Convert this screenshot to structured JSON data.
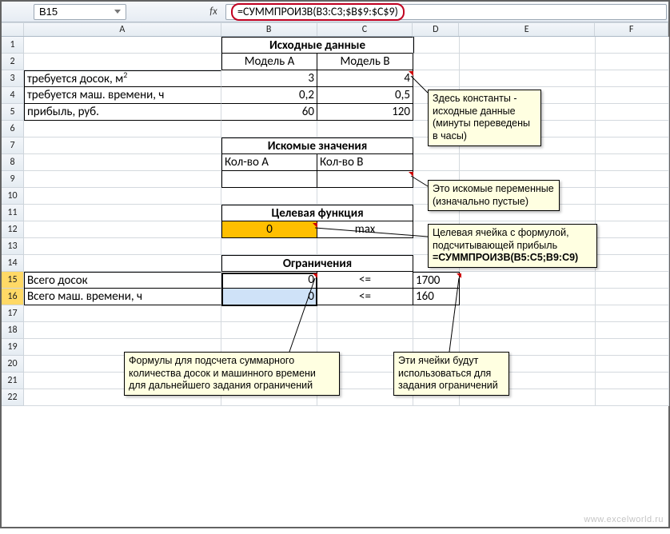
{
  "formula_bar": {
    "name_box": "B15",
    "fx": "fx",
    "formula": "=СУММПРОИЗВ(B3:C3;$B$9:$C$9)"
  },
  "cols": [
    "A",
    "B",
    "C",
    "D",
    "E",
    "F"
  ],
  "rows": [
    "1",
    "2",
    "3",
    "4",
    "5",
    "6",
    "7",
    "8",
    "9",
    "10",
    "11",
    "12",
    "13",
    "14",
    "15",
    "16",
    "17",
    "18",
    "19",
    "20",
    "21",
    "22"
  ],
  "cells": {
    "B1C1": "Исходные данные",
    "B2": "Модель A",
    "C2": "Модель B",
    "A3": "требуется досок, м",
    "A3_sup": "2",
    "B3": "3",
    "C3": "4",
    "A4": "требуется маш. времени, ч",
    "B4": "0,2",
    "C4": "0,5",
    "A5": "прибыль, руб.",
    "B5": "60",
    "C5": "120",
    "B7C7": "Искомые значения",
    "B8": "Кол-во A",
    "C8": "Кол-во B",
    "B11C11": "Целевая функция",
    "B12": "0",
    "C12": "max",
    "B14C14": "Ограничения",
    "A15": "Всего досок",
    "B15": "0",
    "C15": "<=",
    "D15": "1700",
    "A16": "Всего маш. времени, ч",
    "B16": "0",
    "C16": "<=",
    "D16": "160"
  },
  "notes": {
    "n1": [
      "Здесь константы -",
      "исходные данные",
      "(минуты переведены",
      "в часы)"
    ],
    "n2": [
      "Это искомые переменные",
      "(изначально пустые)"
    ],
    "n3_pre": "Целевая ячейка с формулой, подсчитывающей прибыль",
    "n3_bold": "=СУММПРОИЗВ(B5:C5;B9:C9)",
    "n4": [
      "Формулы для подсчета суммарного",
      "количества досок и машинного времени",
      "для дальнейшего задания ограничений"
    ],
    "n5": [
      "Эти ячейки будут",
      "использоваться для",
      "задания ограничений"
    ]
  },
  "watermark": "www.excelworld.ru"
}
